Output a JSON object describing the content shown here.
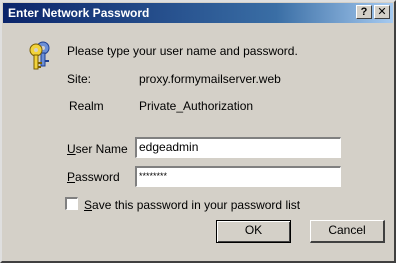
{
  "window": {
    "title": "Enter Network Password",
    "help_glyph": "?",
    "close_glyph": "✕"
  },
  "dialog": {
    "prompt": "Please type your user name and password.",
    "site_label": "Site:",
    "site_value": "proxy.formymailserver.web",
    "realm_label": "Realm",
    "realm_value": "Private_Authorization",
    "user_label_first": "U",
    "user_label_rest": "ser Name",
    "user_value": "edgeadmin",
    "password_label_first": "P",
    "password_label_rest": "assword",
    "password_value": "********",
    "save_label_first": "S",
    "save_label_rest": "ave this password in your password list",
    "save_checked": false
  },
  "buttons": {
    "ok": "OK",
    "cancel": "Cancel"
  },
  "colors": {
    "titlebar_start": "#0a246a",
    "titlebar_end": "#a6caf0",
    "face": "#d4d0c8"
  },
  "icons": {
    "dialog_icon": "keys-icon"
  }
}
